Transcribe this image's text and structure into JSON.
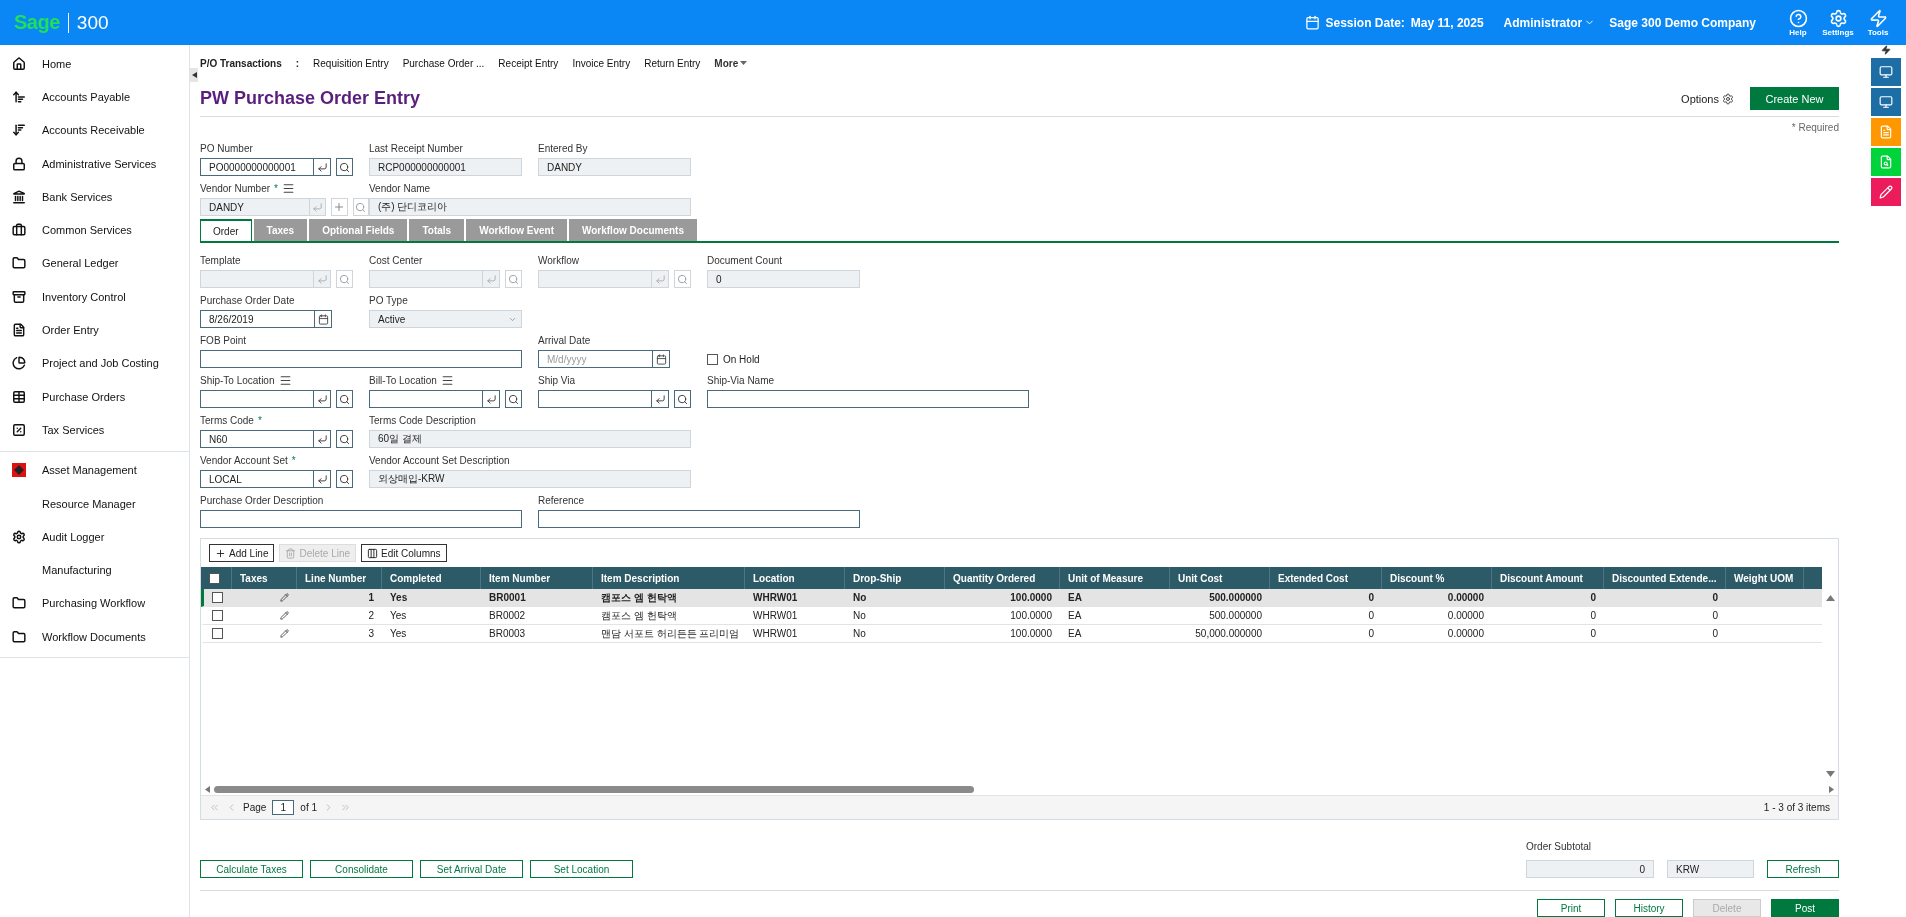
{
  "topbar": {
    "logo": "Sage",
    "product": "300",
    "session_label": "Session Date:",
    "session_date": "May 11, 2025",
    "user": "Administrator",
    "company": "Sage 300 Demo Company",
    "tools": [
      {
        "label": "Help"
      },
      {
        "label": "Settings"
      },
      {
        "label": "Tools"
      }
    ]
  },
  "sidebar": {
    "groups": [
      {
        "items": [
          {
            "label": "Home"
          },
          {
            "label": "Accounts Payable"
          },
          {
            "label": "Accounts Receivable"
          },
          {
            "label": "Administrative Services"
          },
          {
            "label": "Bank Services"
          },
          {
            "label": "Common Services"
          },
          {
            "label": "General Ledger"
          },
          {
            "label": "Inventory Control"
          },
          {
            "label": "Order Entry"
          },
          {
            "label": "Project and Job Costing"
          },
          {
            "label": "Purchase Orders"
          },
          {
            "label": "Tax Services"
          }
        ]
      },
      {
        "items": [
          {
            "label": "Asset Management"
          },
          {
            "label": "Resource Manager"
          },
          {
            "label": "Audit Logger"
          },
          {
            "label": "Manufacturing"
          },
          {
            "label": "Purchasing Workflow"
          },
          {
            "label": "Workflow Documents"
          }
        ]
      }
    ]
  },
  "nav": {
    "section": "P/O Transactions",
    "separator": ":",
    "links": [
      "Requisition Entry",
      "Purchase Order ...",
      "Receipt Entry",
      "Invoice Entry",
      "Return Entry"
    ],
    "more": "More"
  },
  "header": {
    "title": "PW Purchase Order Entry",
    "options": "Options",
    "create_button": "Create New",
    "required_legend": "* Required"
  },
  "form_top": [
    [
      {
        "kind": "lookup",
        "label": "PO Number",
        "value": "PO0000000000001",
        "disabled": false
      },
      {
        "kind": "display",
        "label": "Last Receipt Number",
        "value": "RCP000000000001"
      },
      {
        "kind": "display",
        "label": "Entered By",
        "value": "DANDY"
      }
    ],
    [
      {
        "kind": "lookup",
        "label": "Vendor Number",
        "required_mark": "*",
        "list_icon": true,
        "add_button": true,
        "value": "DANDY",
        "disabled": true
      },
      {
        "kind": "display_wide",
        "label": "Vendor Name",
        "value": "(주) 단디코리아"
      }
    ]
  ],
  "tabs": [
    {
      "label": "Order",
      "selected": true
    },
    {
      "label": "Taxes",
      "selected": false
    },
    {
      "label": "Optional Fields",
      "selected": false
    },
    {
      "label": "Totals",
      "selected": false
    },
    {
      "label": "Workflow Event",
      "selected": false
    },
    {
      "label": "Workflow Documents",
      "selected": false
    }
  ],
  "form_order": [
    [
      {
        "kind": "lookup",
        "label": "Template",
        "disabled": true
      },
      {
        "kind": "lookup",
        "label": "Cost Center",
        "disabled": true
      },
      {
        "kind": "lookup",
        "label": "Workflow",
        "disabled": true
      },
      {
        "kind": "display",
        "label": "Document Count",
        "value": "0"
      }
    ],
    [
      {
        "kind": "date",
        "label": "Purchase Order Date",
        "value": "8/26/2019"
      },
      {
        "kind": "select",
        "label": "PO Type",
        "value": "Active"
      }
    ],
    [
      {
        "kind": "text_wide",
        "label": "FOB Point"
      },
      {
        "kind": "date",
        "label": "Arrival Date",
        "placeholder": "M/d/yyyy"
      },
      {
        "kind": "checkbox",
        "label": "On Hold",
        "checked": false
      }
    ],
    [
      {
        "kind": "lookup",
        "label": "Ship-To Location",
        "list_icon": true,
        "disabled": false
      },
      {
        "kind": "lookup",
        "label": "Bill-To Location",
        "list_icon": true,
        "disabled": false
      },
      {
        "kind": "lookup",
        "label": "Ship Via",
        "disabled": false
      },
      {
        "kind": "text_wide",
        "label": "Ship-Via Name"
      }
    ],
    [
      {
        "kind": "lookup",
        "label": "Terms Code",
        "required_mark": "*",
        "value": "N60",
        "disabled": false
      },
      {
        "kind": "display_wide",
        "label": "Terms Code Description",
        "value": "60일 결제"
      }
    ],
    [
      {
        "kind": "lookup",
        "label": "Vendor Account Set",
        "required_mark": "*",
        "value": "LOCAL",
        "disabled": false
      },
      {
        "kind": "display_wide",
        "label": "Vendor Account Set Description",
        "value": "외상매입-KRW"
      }
    ],
    [
      {
        "kind": "text_wide",
        "label": "Purchase Order Description"
      },
      {
        "kind": "text_wide",
        "label": "Reference"
      }
    ]
  ],
  "grid": {
    "toolbar": [
      {
        "label": "Add Line",
        "disabled": false
      },
      {
        "label": "Delete Line",
        "disabled": true
      },
      {
        "label": "Edit Columns",
        "disabled": false
      }
    ],
    "header_checked": false,
    "columns": [
      {
        "label": "Taxes",
        "kind": "icon"
      },
      {
        "label": "Line Number",
        "kind": "number"
      },
      {
        "label": "Completed",
        "kind": "text"
      },
      {
        "label": "Item Number",
        "kind": "text"
      },
      {
        "label": "Item Description",
        "kind": "text"
      },
      {
        "label": "Location",
        "kind": "text"
      },
      {
        "label": "Drop-Ship",
        "kind": "text"
      },
      {
        "label": "Quantity Ordered",
        "kind": "number"
      },
      {
        "label": "Unit of Measure",
        "kind": "text"
      },
      {
        "label": "Unit Cost",
        "kind": "number"
      },
      {
        "label": "Extended Cost",
        "kind": "number"
      },
      {
        "label": "Discount %",
        "kind": "number"
      },
      {
        "label": "Discount Amount",
        "kind": "number"
      },
      {
        "label": "Discounted Extende...",
        "kind": "number"
      },
      {
        "label": "Weight UOM",
        "kind": "text"
      }
    ],
    "rows": [
      {
        "selected": true,
        "checked": false,
        "cells": [
          "",
          "1",
          "Yes",
          "BR0001",
          "캠포스 엠 헌탁액",
          "WHRW01",
          "No",
          "100.0000",
          "EA",
          "500.000000",
          "0",
          "0.00000",
          "0",
          "0",
          ""
        ]
      },
      {
        "selected": false,
        "checked": false,
        "cells": [
          "",
          "2",
          "Yes",
          "BR0002",
          "캠포스 엠 헌탁액",
          "WHRW01",
          "No",
          "100.0000",
          "EA",
          "500.000000",
          "0",
          "0.00000",
          "0",
          "0",
          ""
        ]
      },
      {
        "selected": false,
        "checked": false,
        "cells": [
          "",
          "3",
          "Yes",
          "BR0003",
          "맨담 서포트 허리든든 프리미엄",
          "WHRW01",
          "No",
          "100.0000",
          "EA",
          "50,000.000000",
          "0",
          "0.00000",
          "0",
          "0",
          ""
        ]
      }
    ],
    "pager": {
      "page_label": "Page",
      "page": "1",
      "of": "of 1",
      "summary": "1 - 3 of 3 items"
    }
  },
  "actions": [
    "Calculate Taxes",
    "Consolidate",
    "Set Arrival Date",
    "Set Location"
  ],
  "subtotal": {
    "label": "Order Subtotal",
    "value": "0",
    "currency": "KRW",
    "refresh": "Refresh"
  },
  "footer_buttons": [
    {
      "label": "Print",
      "kind": "outline"
    },
    {
      "label": "History",
      "kind": "outline"
    },
    {
      "label": "Delete",
      "kind": "disabled"
    },
    {
      "label": "Post",
      "kind": "primary"
    }
  ]
}
